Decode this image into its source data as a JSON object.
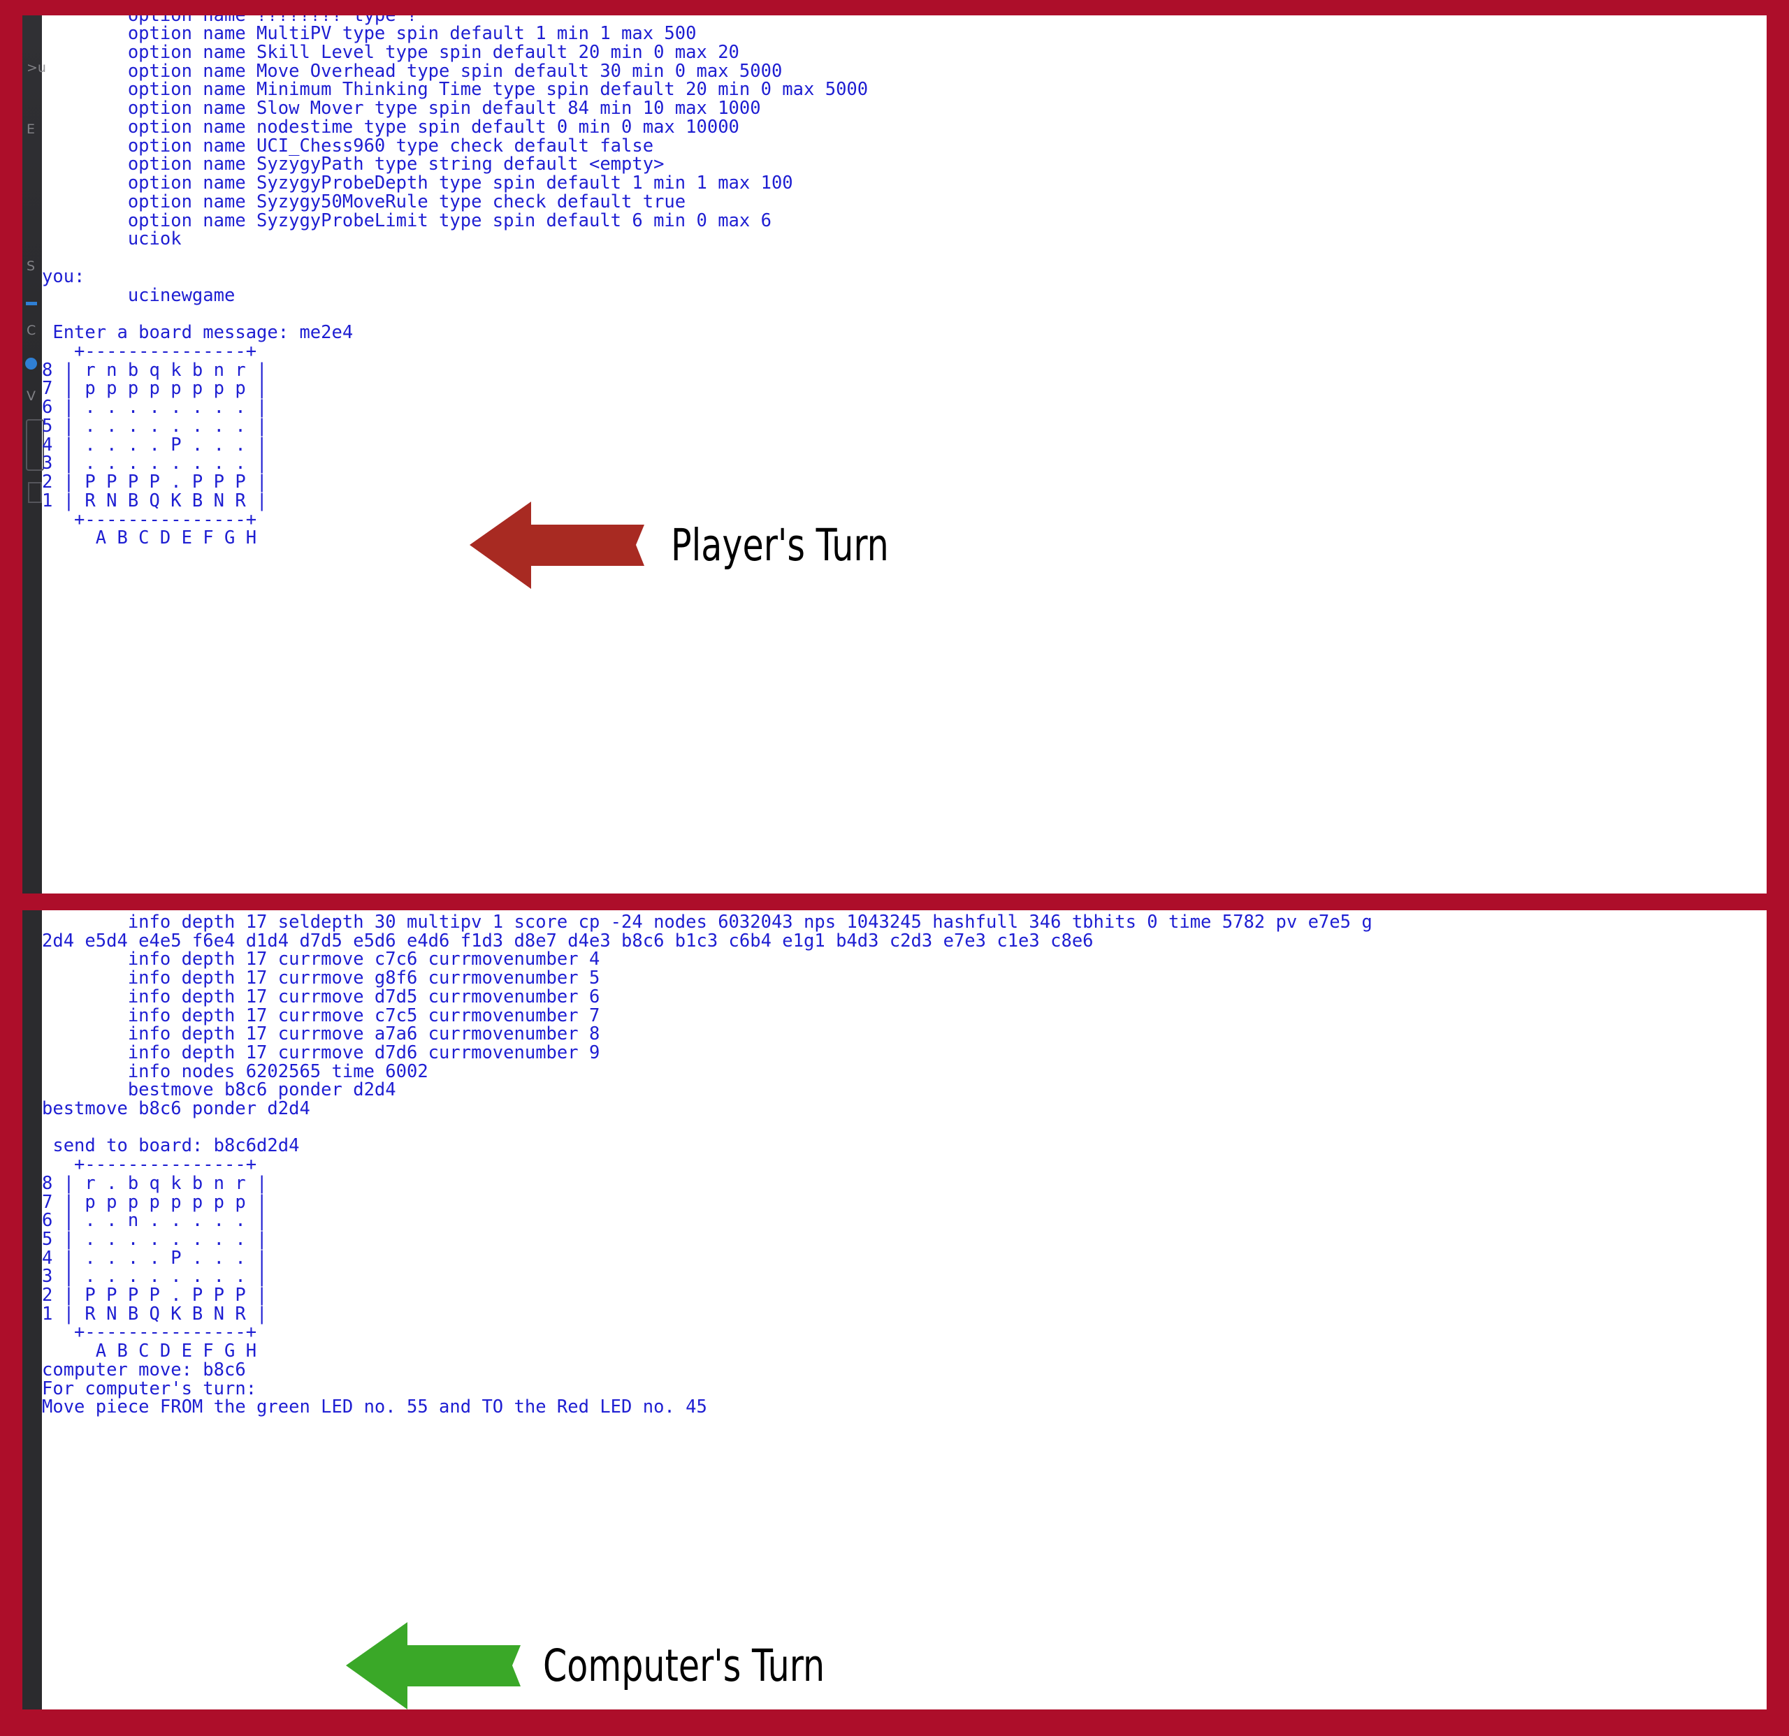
{
  "window": {
    "border_color": "#AD0E2A",
    "terminal_bg": "#FFFFFF",
    "terminal_text_color": "#1E1ED2",
    "sidebar_color": "#2B2B2E"
  },
  "top_panel": {
    "name": "uci-engine-output-top",
    "clipped_first_line": "        option name ???????? type ?",
    "lines": [
      "        option name MultiPV type spin default 1 min 1 max 500",
      "        option name Skill Level type spin default 20 min 0 max 20",
      "        option name Move Overhead type spin default 30 min 0 max 5000",
      "        option name Minimum Thinking Time type spin default 20 min 0 max 5000",
      "        option name Slow Mover type spin default 84 min 10 max 1000",
      "        option name nodestime type spin default 0 min 0 max 10000",
      "        option name UCI_Chess960 type check default false",
      "        option name SyzygyPath type string default <empty>",
      "        option name SyzygyProbeDepth type spin default 1 min 1 max 100",
      "        option name Syzygy50MoveRule type check default true",
      "        option name SyzygyProbeLimit type spin default 6 min 0 max 6",
      "        uciok",
      "",
      "you:",
      "        ucinewgame",
      "",
      " Enter a board message: me2e4",
      "   +---------------+",
      "8 | r n b q k b n r |",
      "7 | p p p p p p p p |",
      "6 | . . . . . . . . |",
      "5 | . . . . . . . . |",
      "4 | . . . . P . . . |",
      "3 | . . . . . . . . |",
      "2 | P P P P . P P P |",
      "1 | R N B Q K B N R |",
      "   +---------------+",
      "     A B C D E F G H"
    ]
  },
  "bottom_panel": {
    "name": "uci-engine-output-bottom",
    "lines": [
      "        info depth 17 seldepth 30 multipv 1 score cp -24 nodes 6032043 nps 1043245 hashfull 346 tbhits 0 time 5782 pv e7e5 g",
      "2d4 e5d4 e4e5 f6e4 d1d4 d7d5 e5d6 e4d6 f1d3 d8e7 d4e3 b8c6 b1c3 c6b4 e1g1 b4d3 c2d3 e7e3 c1e3 c8e6",
      "        info depth 17 currmove c7c6 currmovenumber 4",
      "        info depth 17 currmove g8f6 currmovenumber 5",
      "        info depth 17 currmove d7d5 currmovenumber 6",
      "        info depth 17 currmove c7c5 currmovenumber 7",
      "        info depth 17 currmove a7a6 currmovenumber 8",
      "        info depth 17 currmove d7d6 currmovenumber 9",
      "        info nodes 6202565 time 6002",
      "        bestmove b8c6 ponder d2d4",
      "bestmove b8c6 ponder d2d4",
      "",
      " send to board: b8c6d2d4",
      "   +---------------+",
      "8 | r . b q k b n r |",
      "7 | p p p p p p p p |",
      "6 | . . n . . . . . |",
      "5 | . . . . . . . . |",
      "4 | . . . . P . . . |",
      "3 | . . . . . . . . |",
      "2 | P P P P . P P P |",
      "1 | R N B Q K B N R |",
      "   +---------------+",
      "     A B C D E F G H",
      "computer move: b8c6",
      "For computer's turn:",
      "Move piece FROM the green LED no. 55 and TO the Red LED no. 45"
    ]
  },
  "annotations": {
    "player": {
      "label": "Player's Turn",
      "arrow_color": "#A82A22",
      "arrow_direction": "left"
    },
    "computer": {
      "label": "Computer's Turn",
      "arrow_color": "#3AA828",
      "arrow_direction": "left"
    }
  }
}
